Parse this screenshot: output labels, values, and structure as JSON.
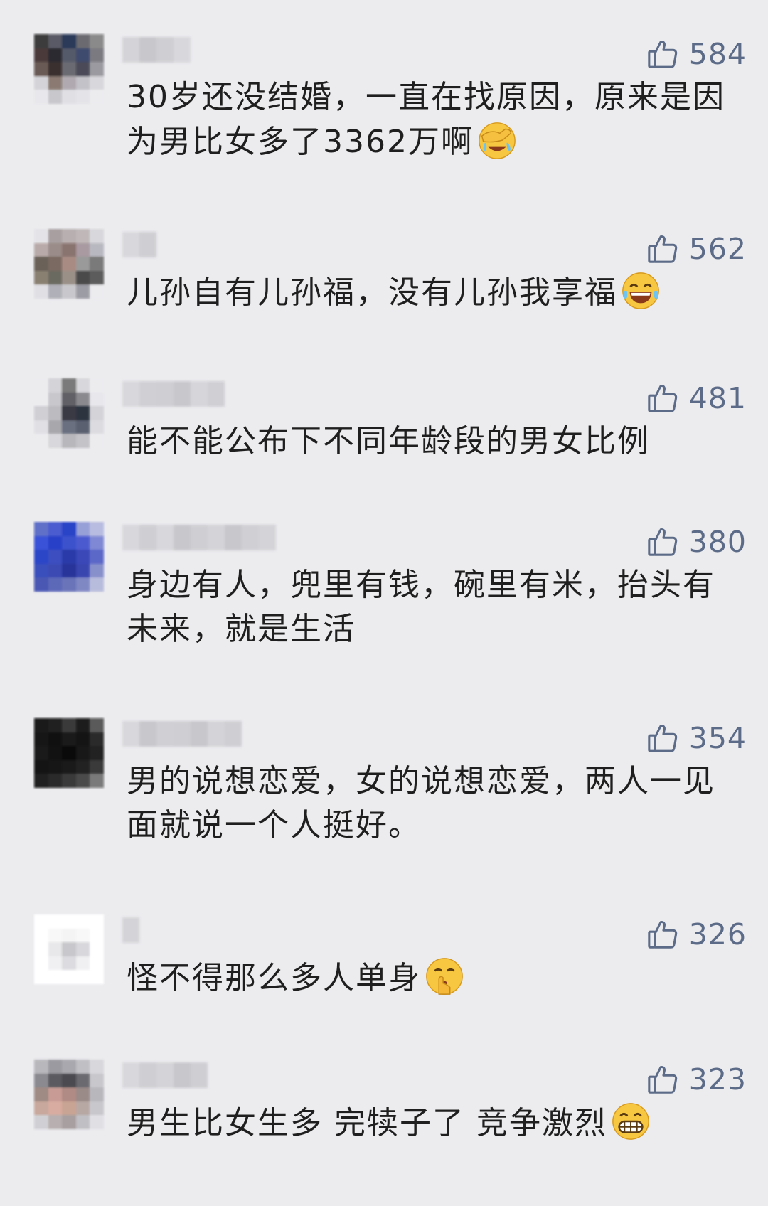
{
  "comments": [
    {
      "text": "30岁还没结婚，一直在找原因，原来是因为男比女多了3362万啊",
      "likes": "584",
      "emoji": "facepalm-cry-emoji",
      "avatar_colors": [
        "#3c3c3c",
        "#5a5a66",
        "#2c3a5a",
        "#6a6a70",
        "#8a8a8a",
        "#4a3a3a",
        "#2a2a30",
        "#555a6a",
        "#3e4a6e",
        "#7a7a80",
        "#6a5a55",
        "#3a3030",
        "#6a6a72",
        "#4a4a58",
        "#9a9aa0",
        "#d4d4d8",
        "#8a7a72",
        "#b0aab0",
        "#c2c2c8",
        "#d8d8dc",
        "#e8e8ec",
        "#c8c8cc",
        "#e0e0e4",
        "#e4e4e8",
        "#ececef"
      ],
      "username_colors": [
        "#d4d4d8",
        "#c8c8cc",
        "#cfcfd3",
        "#d8d8dc"
      ]
    },
    {
      "text": "儿孙自有儿孙福，没有儿孙我享福",
      "likes": "562",
      "emoji": "laughing-tears-emoji",
      "avatar_colors": [
        "#e4e4e8",
        "#a8a0a0",
        "#b8b0b0",
        "#c0b8b8",
        "#d8d8dc",
        "#b8aaa8",
        "#9a8c88",
        "#8a7470",
        "#a89aa0",
        "#b8b8c0",
        "#6a6258",
        "#7a6a62",
        "#a88c84",
        "#9a9a9a",
        "#7a7a7a",
        "#8a8072",
        "#6a6a60",
        "#9a9088",
        "#4a4a4a",
        "#5c5c5c",
        "#e0e0e4",
        "#b0b0b8",
        "#c8c8cc",
        "#9c9ca4",
        "#ececef"
      ],
      "username_colors": [
        "#d8d8dc",
        "#cfcfd3"
      ]
    },
    {
      "text": "能不能公布下不同年龄段的男女比例",
      "likes": "481",
      "emoji": "",
      "avatar_colors": [
        "#ececef",
        "#d4d4d8",
        "#7a7a7a",
        "#d8d8dc",
        "#ececef",
        "#ececef",
        "#c8c8cc",
        "#606066",
        "#8a8a8e",
        "#e8e8ec",
        "#d0d0d4",
        "#bcbcc0",
        "#3a3a44",
        "#2c3440",
        "#d4d4d8",
        "#e0e0e4",
        "#a8a8ac",
        "#6a7080",
        "#5a6070",
        "#dcdce0",
        "#ececef",
        "#d8d8dc",
        "#b8b8bc",
        "#c4c4c8",
        "#ececef"
      ],
      "username_colors": [
        "#d8d8dc",
        "#d0d0d4",
        "#cfcfd3",
        "#c8c8cc",
        "#d6d6da",
        "#d0d0d4"
      ]
    },
    {
      "text": "身边有人，兜里有钱，碗里有米，抬头有未来，就是生活",
      "likes": "380",
      "emoji": "",
      "avatar_colors": [
        "#6070c8",
        "#4a5cd0",
        "#2a44c8",
        "#98a0d8",
        "#b8bce0",
        "#3a52d8",
        "#2840c8",
        "#3c52cc",
        "#4c5ad0",
        "#7e88d4",
        "#2c46c8",
        "#3c4ec0",
        "#2a3aa8",
        "#3a48b8",
        "#5c68c8",
        "#3a4ebc",
        "#3c4ab4",
        "#28349a",
        "#3a46b0",
        "#8890cc",
        "#4a58b4",
        "#5c68b8",
        "#6a74b8",
        "#8088c4",
        "#b8bcdc"
      ],
      "username_colors": [
        "#d8d8dc",
        "#cfcfd3",
        "#d8d8dc",
        "#c8c8cc",
        "#cfcfd3",
        "#d4d4d8",
        "#c8c8cc",
        "#d0d0d4",
        "#d4d4d8"
      ]
    },
    {
      "text": "男的说想恋爱，女的说想恋爱，两人一见面就说一个人挺好。",
      "likes": "354",
      "emoji": "",
      "avatar_colors": [
        "#1a1a1a",
        "#202020",
        "#3a3a3a",
        "#1c1c1c",
        "#5a5a5a",
        "#161616",
        "#101010",
        "#1a1a1a",
        "#141414",
        "#2a2a2a",
        "#1a1a1a",
        "#121212",
        "#0a0a0a",
        "#181818",
        "#222222",
        "#141414",
        "#161616",
        "#1a1a1a",
        "#222222",
        "#3a3a3a",
        "#202020",
        "#2a2a2a",
        "#3a3a3a",
        "#4a4a4a",
        "#7a7a7a"
      ],
      "username_colors": [
        "#d8d8dc",
        "#c8c8cc",
        "#d0d0d4",
        "#cfcfd3",
        "#c8c8cc",
        "#d4d4d8",
        "#cfcfd3"
      ]
    },
    {
      "text": "怪不得那么多人单身",
      "likes": "326",
      "emoji": "shushing-face-emoji",
      "avatar_colors": [
        "#ffffff",
        "#ffffff",
        "#ffffff",
        "#ffffff",
        "#ffffff",
        "#ffffff",
        "#f8f8f8",
        "#f4f4f4",
        "#f8f8f8",
        "#ffffff",
        "#ffffff",
        "#e8e8ea",
        "#c8c8cc",
        "#d8d8dc",
        "#ffffff",
        "#ffffff",
        "#f0f0f2",
        "#dcdce0",
        "#f0f0f2",
        "#ffffff",
        "#ffffff",
        "#ffffff",
        "#ffffff",
        "#ffffff",
        "#ffffff"
      ],
      "username_colors": [
        "#d4d4d8"
      ]
    },
    {
      "text": "男生比女生多 完犊子了 竞争激烈",
      "likes": "323",
      "emoji": "grinning-emoji",
      "avatar_colors": [
        "#b8b8bc",
        "#9a9aa0",
        "#a8a8ae",
        "#c0c0c4",
        "#d8d8dc",
        "#8a8a90",
        "#5a5a60",
        "#4a4a50",
        "#6a6a70",
        "#c8c8cc",
        "#a08a84",
        "#c89c94",
        "#b08a84",
        "#9a8a88",
        "#b8b8bc",
        "#c8a89c",
        "#d8aca0",
        "#c8a494",
        "#b8a8a4",
        "#c8c8cc",
        "#d0d0d4",
        "#b8b0b0",
        "#a8a0a0",
        "#c0c0c4",
        "#e0e0e4"
      ],
      "username_colors": [
        "#d8d8dc",
        "#cfcfd3",
        "#d4d4d8",
        "#c8c8cc",
        "#cfcfd3"
      ]
    }
  ]
}
